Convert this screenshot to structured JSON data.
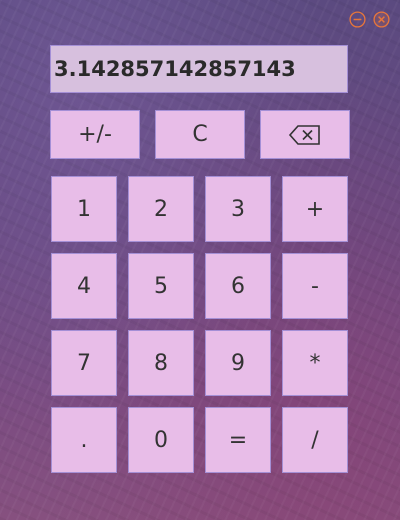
{
  "window_controls": {
    "minimize_icon": "minimize-circle-icon",
    "close_icon": "close-circle-icon",
    "accent_color": "#e8763a"
  },
  "display": {
    "value": "3.142857142857143"
  },
  "top_row": [
    {
      "label": "+/-",
      "name": "negate-button"
    },
    {
      "label": "C",
      "name": "clear-button"
    },
    {
      "label": "",
      "name": "backspace-button",
      "icon": "backspace-icon"
    }
  ],
  "keypad": [
    [
      {
        "label": "1",
        "name": "digit-1-button"
      },
      {
        "label": "2",
        "name": "digit-2-button"
      },
      {
        "label": "3",
        "name": "digit-3-button"
      },
      {
        "label": "+",
        "name": "add-button"
      }
    ],
    [
      {
        "label": "4",
        "name": "digit-4-button"
      },
      {
        "label": "5",
        "name": "digit-5-button"
      },
      {
        "label": "6",
        "name": "digit-6-button"
      },
      {
        "label": "-",
        "name": "subtract-button"
      }
    ],
    [
      {
        "label": "7",
        "name": "digit-7-button"
      },
      {
        "label": "8",
        "name": "digit-8-button"
      },
      {
        "label": "9",
        "name": "digit-9-button"
      },
      {
        "label": "*",
        "name": "multiply-button"
      }
    ],
    [
      {
        "label": ".",
        "name": "decimal-button"
      },
      {
        "label": "0",
        "name": "digit-0-button"
      },
      {
        "label": "=",
        "name": "equals-button"
      },
      {
        "label": "/",
        "name": "divide-button"
      }
    ]
  ],
  "colors": {
    "button_fill": "#e8bde8",
    "button_border": "#a48fd6",
    "display_fill": "#d7c0de",
    "text": "#333333"
  }
}
